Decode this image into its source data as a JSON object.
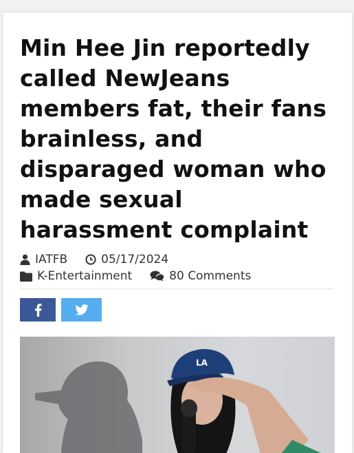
{
  "article": {
    "title": "Min Hee Jin reportedly called NewJeans members fat, their fans brainless, and disparaged woman who made sexual harassment complaint",
    "author": "IATFB",
    "date": "05/17/2024",
    "category": "K-Entertainment",
    "comments": "80 Comments"
  },
  "share": {
    "facebook_color": "#3b5998",
    "twitter_color": "#55acee"
  },
  "icons": {
    "author": "user-icon",
    "date": "clock-icon",
    "category": "folder-icon",
    "comments": "comments-icon",
    "facebook": "facebook-icon",
    "twitter": "twitter-icon"
  },
  "colors": {
    "title": "#111111",
    "meta": "#333333",
    "card": "#ffffff",
    "background": "#f1f1f1"
  }
}
